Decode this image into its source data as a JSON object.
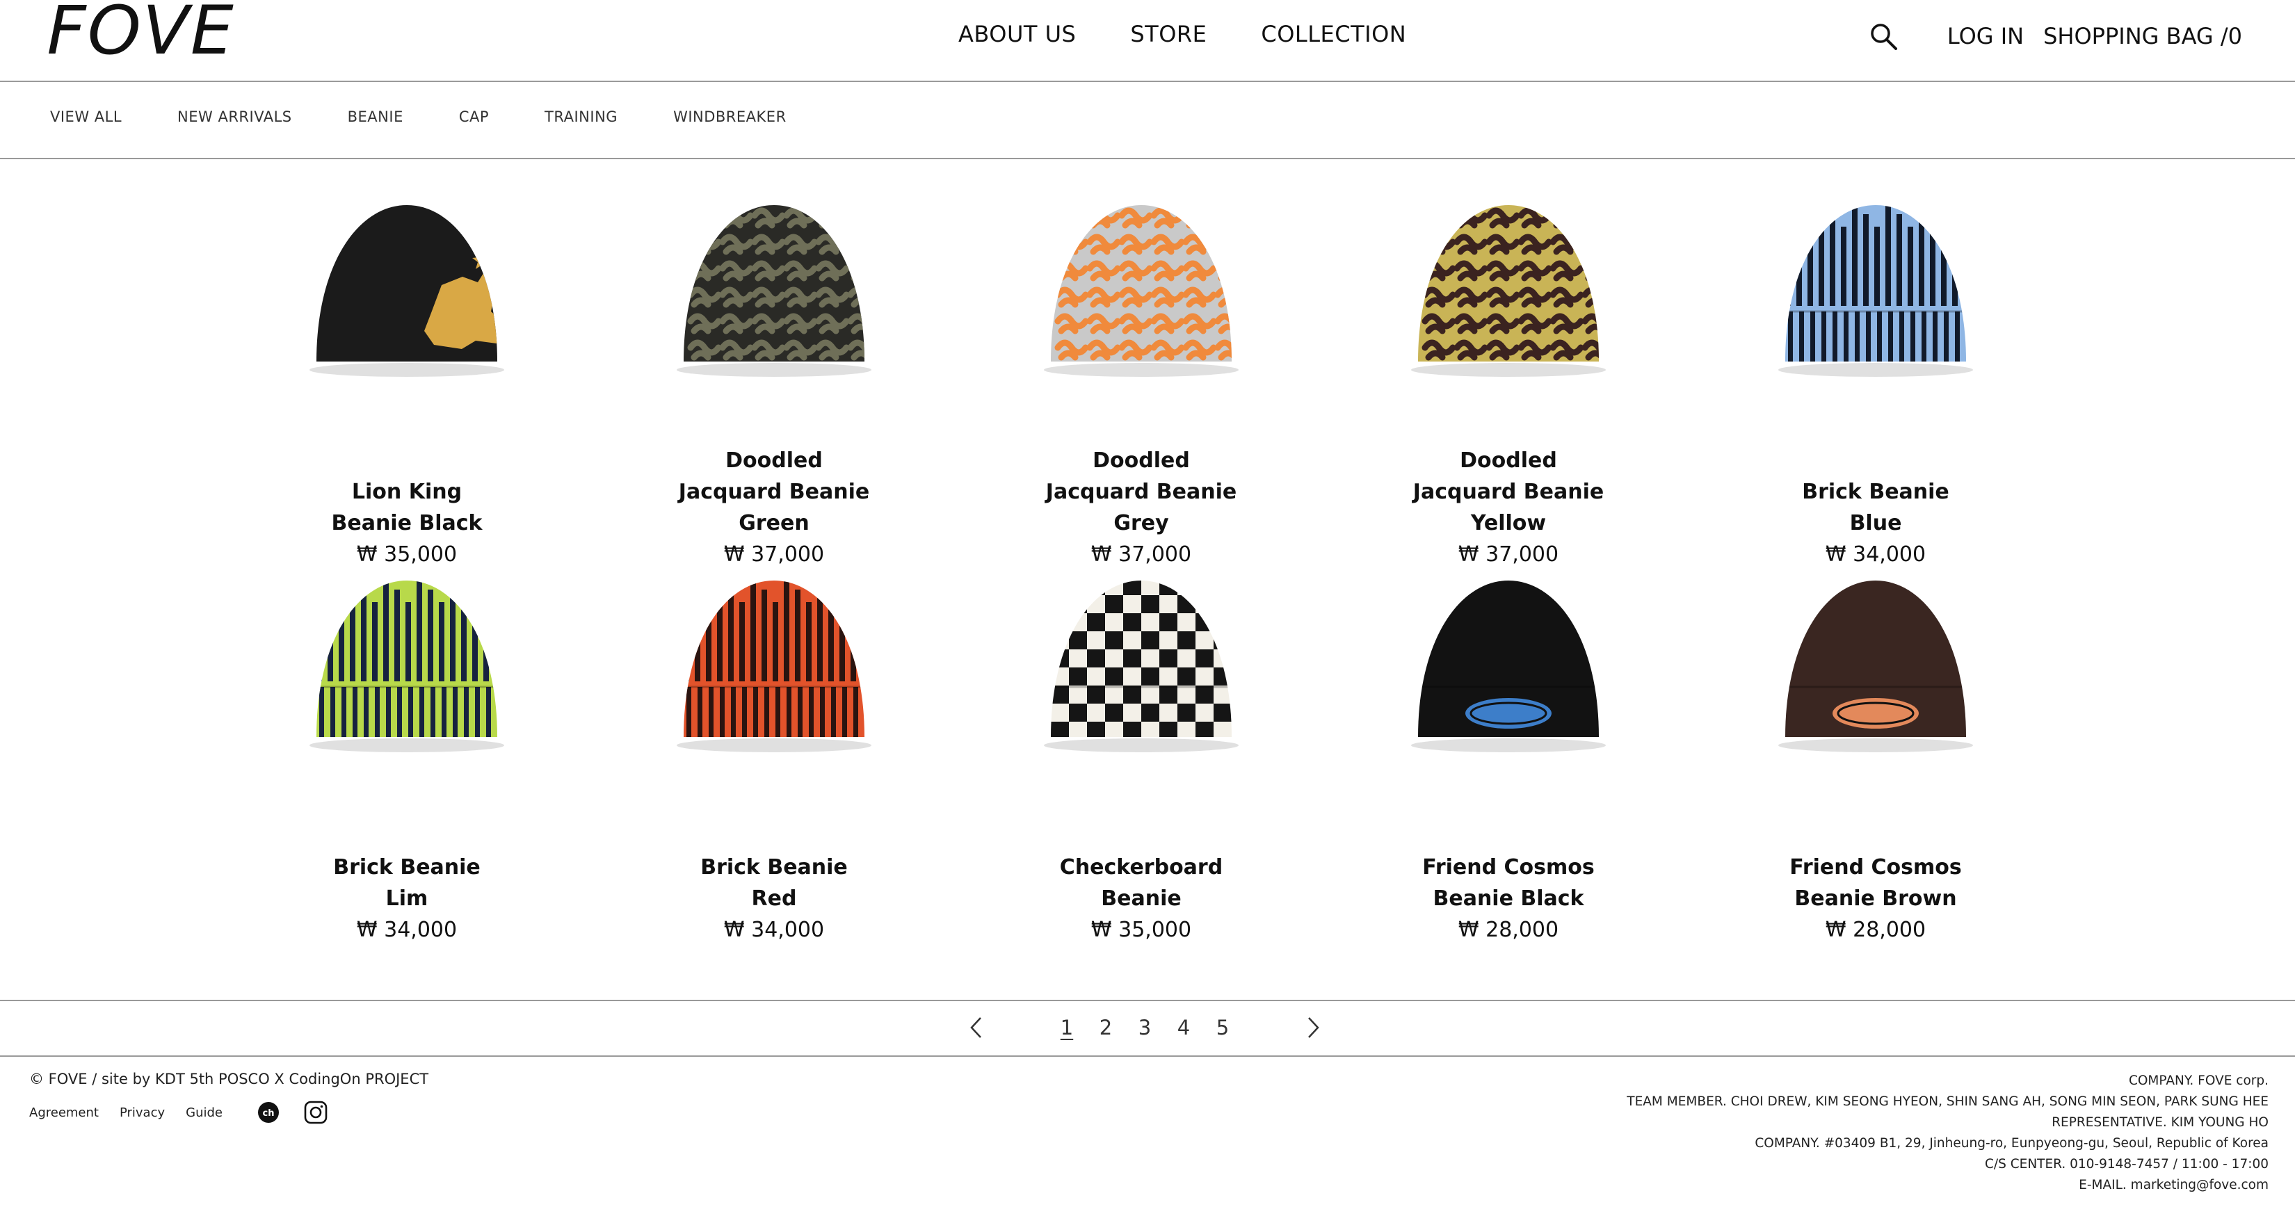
{
  "header": {
    "logo": "FOVE",
    "nav": [
      "ABOUT US",
      "STORE",
      "COLLECTION"
    ],
    "search_icon": "search-icon",
    "login": "LOG IN",
    "bag": "SHOPPING BAG /0"
  },
  "subnav": [
    "VIEW ALL",
    "NEW ARRIVALS",
    "BEANIE",
    "CAP",
    "TRAINING",
    "WINDBREAKER"
  ],
  "products": [
    {
      "name": "Lion King Beanie Black",
      "price": "₩ 35,000",
      "style": "lion",
      "colors": [
        "#1b1b1b",
        "#d9a845"
      ]
    },
    {
      "name": "Doodled Jacquard Beanie Green",
      "price": "₩ 37,000",
      "style": "doodle",
      "colors": [
        "#2a2a26",
        "#6f6f58"
      ]
    },
    {
      "name": "Doodled Jacquard Beanie Grey",
      "price": "₩ 37,000",
      "style": "doodle",
      "colors": [
        "#c9c9c9",
        "#f08a3c"
      ]
    },
    {
      "name": "Doodled Jacquard Beanie Yellow",
      "price": "₩ 37,000",
      "style": "doodle",
      "colors": [
        "#c9b456",
        "#3b2320"
      ]
    },
    {
      "name": "Brick Beanie Blue",
      "price": "₩ 34,000",
      "style": "brick",
      "colors": [
        "#8fb6e4",
        "#111a2a"
      ]
    },
    {
      "name": "Brick Beanie Lim",
      "price": "₩ 34,000",
      "style": "brick",
      "colors": [
        "#b8d94a",
        "#16223f"
      ]
    },
    {
      "name": "Brick Beanie Red",
      "price": "₩ 34,000",
      "style": "brick",
      "colors": [
        "#e2532b",
        "#2a1410"
      ]
    },
    {
      "name": "Checkerboard Beanie",
      "price": "₩ 35,000",
      "style": "checker",
      "colors": [
        "#f3f0e8",
        "#151515"
      ]
    },
    {
      "name": "Friend Cosmos Beanie Black",
      "price": "₩ 28,000",
      "style": "cosmos",
      "colors": [
        "#121212",
        "#3d7ec9"
      ]
    },
    {
      "name": "Friend Cosmos Beanie Brown",
      "price": "₩ 28,000",
      "style": "cosmos",
      "colors": [
        "#3a2621",
        "#e3895b"
      ]
    }
  ],
  "pagination": {
    "pages": [
      "1",
      "2",
      "3",
      "4",
      "5"
    ],
    "current": "1",
    "prev_icon": "chevron-left-icon",
    "next_icon": "chevron-right-icon"
  },
  "footer": {
    "copyright": "© FOVE / site by KDT 5th POSCO X CodingOn PROJECT",
    "links": [
      "Agreement",
      "Privacy",
      "Guide"
    ],
    "social_icons": [
      "kakao-channel-icon",
      "instagram-icon"
    ],
    "info": [
      "COMPANY. FOVE corp.",
      "TEAM MEMBER. CHOI DREW, KIM SEONG HYEON, SHIN SANG AH, SONG MIN SEON, PARK SUNG HEE",
      "REPRESENTATIVE. KIM YOUNG HO",
      "COMPANY. #03409 B1, 29, Jinheung-ro, Eunpyeong-gu, Seoul, Republic of Korea",
      "C/S CENTER. 010-9148-7457 / 11:00 - 17:00",
      "E-MAIL. marketing@fove.com"
    ]
  }
}
